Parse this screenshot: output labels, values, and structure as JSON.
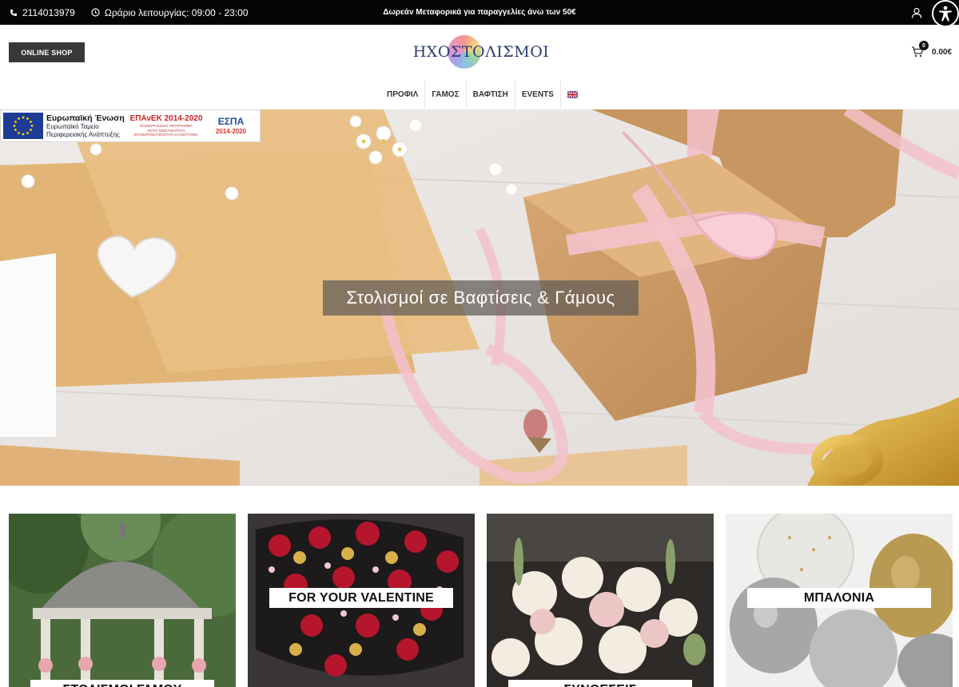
{
  "topbar": {
    "phone": "2114013979",
    "hours": "Ωράριο λειτουργίας: 09:00 - 23:00",
    "promo": "Δωρεάν Μεταφορικά για παραγγελίες άνω των 50€"
  },
  "header": {
    "online_shop_label": "ONLINE SHOP",
    "logo_text": "ΗΧΟΣΤΟΛΙΣΜΟΙ",
    "cart_count": "0",
    "cart_total": "0.00€"
  },
  "nav": {
    "items": [
      "ΠΡΟΦΙΛ",
      "ΓΑΜΟΣ",
      "ΒΑΦΤΙΣΗ",
      "EVENTS"
    ]
  },
  "espa_banner": {
    "eu_title": "Ευρωπαϊκή Ένωση",
    "eu_fund": "Ευρωπαϊκό Ταμείο",
    "eu_dev": "Περιφερειακής Ανάπτυξης",
    "epanek_title": "ΕΠΑνΕΚ 2014-2020",
    "epanek_sub": "ΕΠΙΧΕΙΡΗΣΙΑΚΟ ΠΡΟΓΡΑΜΜΑ ΑΝΤΑΓΩΝΙΣΤΙΚΟΤΗΤΑ ΕΠΙΧΕΙΡΗΜΑΤΙΚΟΤΗΤΑ ΚΑΙΝΟΤΟΜΙΑ",
    "espa_title": "ΕΣΠΑ",
    "espa_years": "2014-2020"
  },
  "hero": {
    "title": "Στολισμοί σε Βαφτίσεις & Γάμους"
  },
  "categories": [
    {
      "label": "ΣΤΟΛΙΣΜΟΙ ΓΑΜΟΥ"
    },
    {
      "label": "FOR YOUR VALENTINE"
    },
    {
      "label": "ΣΥΝΘΕΣΕΙΣ"
    },
    {
      "label": "ΜΠΑΛΟΝΙΑ"
    }
  ],
  "colors": {
    "topbar_bg": "#050505",
    "online_shop_bg": "#383838",
    "logo_text": "#2b3c73",
    "hero_label_bg": "#5f5a55"
  },
  "icons": {
    "phone": "phone-icon",
    "clock": "clock-icon",
    "user": "user-icon",
    "accessibility": "accessibility-icon",
    "cart": "cart-icon",
    "language_flag": "uk-flag-icon"
  }
}
